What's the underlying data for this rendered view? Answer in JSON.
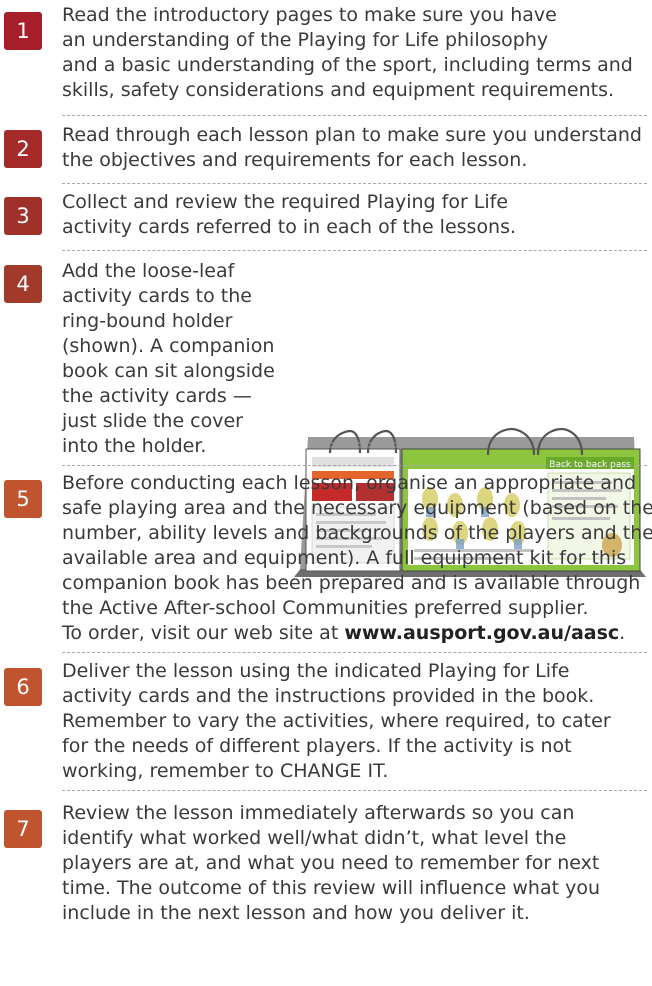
{
  "steps": [
    {
      "number": "1",
      "lines": [
        "Read the introductory pages to make sure you have",
        "an understanding of the Playing for Life philosophy",
        "and a basic understanding of the sport, including terms and",
        "skills, safety considerations and equipment requirements."
      ]
    },
    {
      "number": "2",
      "lines": [
        "Read through each lesson plan to make sure you understand",
        "the objectives and requirements for each lesson."
      ]
    },
    {
      "number": "3",
      "lines": [
        "Collect and review the required Playing for Life",
        "activity cards referred to in each of the lessons."
      ]
    },
    {
      "number": "4",
      "lines": [
        "Add the loose-leaf",
        "activity cards to the",
        "ring-bound holder",
        "(shown). A companion",
        "book can sit alongside",
        "the activity cards —",
        "just slide the cover",
        "into the holder."
      ]
    },
    {
      "number": "5",
      "lines": [
        "Before conducting each lesson, organise an appropriate and",
        "safe playing area and the necessary equipment (based on the",
        "number, ability levels and backgrounds of the players and the",
        "available area and equipment). A full equipment kit for this",
        "companion book has been prepared and is available through",
        "the Active After-school Communities preferred supplier."
      ],
      "last_line_prefix": "To order, visit our web site at ",
      "url": "www.ausport.gov.au/aasc",
      "last_line_suffix": "."
    },
    {
      "number": "6",
      "lines": [
        "Deliver the lesson using the indicated Playing for Life",
        "activity cards and the instructions provided in the book.",
        "Remember to vary the activities, where required, to cater",
        "for the needs of different players. If the activity is not",
        "working, remember to CHANGE IT."
      ]
    },
    {
      "number": "7",
      "lines": [
        "Review the lesson immediately afterwards so you can",
        "identify what worked well/what didn’t, what level the",
        "players are at, and what you need to remember for next",
        "time. The outcome of this review will influence what you",
        "include in the next lesson and how you deliver it."
      ]
    }
  ],
  "illustration": {
    "card_title": "Back to back pass",
    "icon": "activity-card-holder-illustration"
  },
  "colors": {
    "badge_red": "#a51e2a",
    "badge_red2": "#a0302a",
    "badge_orange": "#c0542e",
    "card_green": "#8cc63f",
    "holder_grey": "#8a8a8a"
  }
}
